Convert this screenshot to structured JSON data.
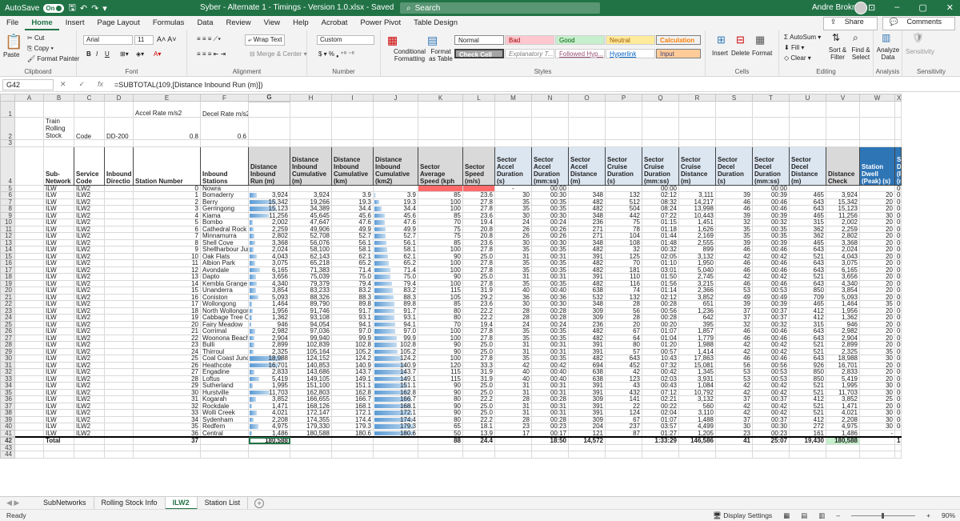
{
  "titlebar": {
    "autosave": "AutoSave",
    "toggle": "On",
    "title": "Syber - Alternate 1 - Timings - Version 1.0.xlsx  -  Saved",
    "search": "Search",
    "user": "Andre Brokman"
  },
  "menu": {
    "items": [
      "File",
      "Home",
      "Insert",
      "Page Layout",
      "Formulas",
      "Data",
      "Review",
      "View",
      "Help",
      "Acrobat",
      "Power Pivot",
      "Table Design"
    ],
    "share": "Share",
    "comments": "Comments"
  },
  "ribbon": {
    "clipboard": {
      "paste": "Paste",
      "cut": "Cut",
      "copy": "Copy",
      "format_painter": "Format Painter",
      "label": "Clipboard"
    },
    "font": {
      "name": "Arial",
      "size": "11",
      "label": "Font"
    },
    "alignment": {
      "wrap": "Wrap Text",
      "merge": "Merge & Center",
      "label": "Alignment"
    },
    "number": {
      "format": "Custom",
      "label": "Number"
    },
    "styles": {
      "conditional": "Conditional Formatting",
      "format_as_table": "Format as Table",
      "normal": "Normal",
      "bad": "Bad",
      "good": "Good",
      "neutral": "Neutral",
      "calculation": "Calculation",
      "check_cell": "Check Cell",
      "explanatory": "Explanatory T...",
      "followed": "Followed Hyp...",
      "hyperlink": "Hyperlink",
      "input": "Input",
      "label": "Styles"
    },
    "cells": {
      "insert": "Insert",
      "delete": "Delete",
      "format": "Format",
      "label": "Cells"
    },
    "editing": {
      "autosum": "AutoSum",
      "fill": "Fill",
      "clear": "Clear",
      "sort": "Sort & Filter",
      "find": "Find & Select",
      "label": "Editing"
    },
    "analysis": {
      "analyze": "Analyze Data",
      "label": "Analysis"
    },
    "sensitivity": {
      "name": "Sensitivity",
      "label": "Sensitivity"
    }
  },
  "formula": {
    "cell": "G42",
    "fx": "fx",
    "value": "=SUBTOTAL(109,[Distance Inbound Run (m)])"
  },
  "columns": [
    "A",
    "B",
    "C",
    "D",
    "E",
    "F",
    "G",
    "H",
    "I",
    "J",
    "K",
    "L",
    "M",
    "N",
    "O",
    "P",
    "Q",
    "R",
    "S",
    "T",
    "U",
    "V",
    "W",
    "X",
    "Y"
  ],
  "top_rows": {
    "r1": {
      "e": "Accel Rate m/s2",
      "f": "Decel Rate m/s2"
    },
    "r2": {
      "b": "Train Rolling Stock",
      "c": "Code",
      "d": "DD-200",
      "e": "0.8",
      "f": "0.6"
    }
  },
  "headers": [
    "Sub-Network",
    "Service Code",
    "Inbound Directio",
    "Station Number",
    "Inbound Stations",
    "Distance Inbound Run (m)",
    "Distance Inbound Cumulative (m)",
    "Distance Inbound Cumulative (km)",
    "Distance Inbound Cumulative (km2)",
    "Sector Average Speed (kph",
    "Sector Speed (m/s)",
    "Sector Accel Duration (s)",
    "Sector Accel Duration (mm:ss)",
    "Sector Accel Distance (m)",
    "Sector Cruise Duration (s)",
    "Sector Cruise Duration (mm:ss)",
    "Sector Cruise Distance (m)",
    "Sector Decel Duration (s)",
    "Sector Decel Duration (mm:ss)",
    "Sector Decel Distance (m)",
    "Distance Check",
    "Station Dwell (Peak) (s)",
    "Station Dwell (Peak) (mm:ss)",
    "Sector Travel (s)"
  ],
  "rows": [
    [
      "ILW",
      "ILW2",
      "",
      "0",
      "Nowra",
      "",
      "",
      "",
      "",
      "",
      "",
      "-",
      "00:00",
      "",
      "",
      "00:00",
      "",
      "",
      "00:00",
      "",
      "",
      "",
      "00:00",
      ""
    ],
    [
      "ILW",
      "ILW2",
      "",
      "1",
      "Bomaderry",
      "3,924",
      "3,924",
      "3.9",
      "3.9",
      "85",
      "23.6",
      "30",
      "00:30",
      "348",
      "132",
      "02:12",
      "3,111",
      "39",
      "00:39",
      "465",
      "3,924",
      "20",
      "00:20",
      ""
    ],
    [
      "ILW",
      "ILW2",
      "",
      "2",
      "Berry",
      "15,342",
      "19,266",
      "19.3",
      "19.3",
      "100",
      "27.8",
      "35",
      "00:35",
      "482",
      "512",
      "08:32",
      "14,217",
      "46",
      "00:46",
      "643",
      "15,342",
      "20",
      "00:20",
      ""
    ],
    [
      "ILW",
      "ILW2",
      "",
      "3",
      "Gerringong",
      "15,123",
      "34,389",
      "34.4",
      "34.4",
      "100",
      "27.8",
      "35",
      "00:35",
      "482",
      "504",
      "08:24",
      "13,998",
      "46",
      "00:46",
      "643",
      "15,123",
      "20",
      "00:20",
      ""
    ],
    [
      "ILW",
      "ILW2",
      "",
      "4",
      "Kiama",
      "11,256",
      "45,645",
      "45.6",
      "45.6",
      "85",
      "23.6",
      "30",
      "00:30",
      "348",
      "442",
      "07:22",
      "10,443",
      "39",
      "00:39",
      "465",
      "11,256",
      "30",
      "00:30",
      ""
    ],
    [
      "ILW",
      "ILW2",
      "",
      "5",
      "Bombo",
      "2,002",
      "47,647",
      "47.6",
      "47.6",
      "70",
      "19.4",
      "24",
      "00:24",
      "236",
      "75",
      "01:15",
      "1,451",
      "32",
      "00:32",
      "315",
      "2,002",
      "20",
      "00:20",
      ""
    ],
    [
      "ILW",
      "ILW2",
      "",
      "6",
      "Cathedral Rock",
      "2,259",
      "49,906",
      "49.9",
      "49.9",
      "75",
      "20.8",
      "26",
      "00:26",
      "271",
      "78",
      "01:18",
      "1,626",
      "35",
      "00:35",
      "362",
      "2,259",
      "20",
      "00:20",
      ""
    ],
    [
      "ILW",
      "ILW2",
      "",
      "7",
      "Minnamurra",
      "2,802",
      "52,708",
      "52.7",
      "52.7",
      "75",
      "20.8",
      "26",
      "00:26",
      "271",
      "104",
      "01:44",
      "2,169",
      "35",
      "00:35",
      "362",
      "2,802",
      "20",
      "00:20",
      ""
    ],
    [
      "ILW",
      "ILW2",
      "",
      "8",
      "Shell Cove",
      "3,368",
      "56,076",
      "56.1",
      "56.1",
      "85",
      "23.6",
      "30",
      "00:30",
      "348",
      "108",
      "01:48",
      "2,555",
      "39",
      "00:39",
      "465",
      "3,368",
      "20",
      "00:20",
      ""
    ],
    [
      "ILW",
      "ILW2",
      "",
      "9",
      "Shellharbour Junction",
      "2,024",
      "58,100",
      "58.1",
      "58.1",
      "100",
      "27.8",
      "35",
      "00:35",
      "482",
      "32",
      "00:32",
      "899",
      "46",
      "00:46",
      "643",
      "2,024",
      "20",
      "00:20",
      ""
    ],
    [
      "ILW",
      "ILW2",
      "",
      "10",
      "Oak Flats",
      "4,043",
      "62,143",
      "62.1",
      "62.1",
      "90",
      "25.0",
      "31",
      "00:31",
      "391",
      "125",
      "02:05",
      "3,132",
      "42",
      "00:42",
      "521",
      "4,043",
      "20",
      "00:20",
      ""
    ],
    [
      "ILW",
      "ILW2",
      "",
      "11",
      "Albion Park",
      "3,075",
      "65,218",
      "65.2",
      "65.2",
      "100",
      "27.8",
      "35",
      "00:35",
      "482",
      "70",
      "01:10",
      "1,950",
      "46",
      "00:46",
      "643",
      "3,075",
      "20",
      "00:20",
      ""
    ],
    [
      "ILW",
      "ILW2",
      "",
      "12",
      "Avondale",
      "6,165",
      "71,383",
      "71.4",
      "71.4",
      "100",
      "27.8",
      "35",
      "00:35",
      "482",
      "181",
      "03:01",
      "5,040",
      "46",
      "00:46",
      "643",
      "6,165",
      "20",
      "00:20",
      ""
    ],
    [
      "ILW",
      "ILW2",
      "",
      "13",
      "Dapto",
      "3,656",
      "75,039",
      "75.0",
      "75.0",
      "90",
      "25.0",
      "31",
      "00:31",
      "391",
      "110",
      "01:50",
      "2,745",
      "42",
      "00:42",
      "521",
      "3,656",
      "20",
      "00:20",
      ""
    ],
    [
      "ILW",
      "ILW2",
      "",
      "14",
      "Kembla Grange",
      "4,340",
      "79,379",
      "79.4",
      "79.4",
      "100",
      "27.8",
      "35",
      "00:35",
      "482",
      "116",
      "01:56",
      "3,215",
      "46",
      "00:46",
      "643",
      "4,340",
      "20",
      "00:20",
      ""
    ],
    [
      "ILW",
      "ILW2",
      "",
      "15",
      "Unanderra",
      "3,854",
      "83,233",
      "83.2",
      "83.2",
      "115",
      "31.9",
      "40",
      "00:40",
      "638",
      "74",
      "01:14",
      "2,366",
      "53",
      "00:53",
      "850",
      "3,854",
      "20",
      "00:20",
      ""
    ],
    [
      "ILW",
      "ILW2",
      "",
      "16",
      "Coniston",
      "5,093",
      "88,326",
      "88.3",
      "88.3",
      "105",
      "29.2",
      "36",
      "00:36",
      "532",
      "132",
      "02:12",
      "3,852",
      "49",
      "00:49",
      "709",
      "5,093",
      "20",
      "00:20",
      ""
    ],
    [
      "ILW",
      "ILW2",
      "",
      "17",
      "Wollongong",
      "1,464",
      "89,790",
      "89.8",
      "89.8",
      "85",
      "23.6",
      "30",
      "00:30",
      "348",
      "28",
      "00:28",
      "651",
      "39",
      "00:39",
      "465",
      "1,464",
      "35",
      "00:35",
      ""
    ],
    [
      "ILW",
      "ILW2",
      "",
      "18",
      "North Wollongong",
      "1,956",
      "91,746",
      "91.7",
      "91.7",
      "80",
      "22.2",
      "28",
      "00:28",
      "309",
      "56",
      "00:56",
      "1,236",
      "37",
      "00:37",
      "412",
      "1,956",
      "20",
      "00:20",
      ""
    ],
    [
      "ILW",
      "ILW2",
      "",
      "19",
      "Cabbage Tree Creek",
      "1,362",
      "93,108",
      "93.1",
      "93.1",
      "80",
      "22.2",
      "28",
      "00:28",
      "309",
      "28",
      "00:28",
      "642",
      "37",
      "00:37",
      "412",
      "1,362",
      "20",
      "00:20",
      ""
    ],
    [
      "ILW",
      "ILW2",
      "",
      "20",
      "Fairy Meadow",
      "946",
      "94,054",
      "94.1",
      "94.1",
      "70",
      "19.4",
      "24",
      "00:24",
      "236",
      "20",
      "00:20",
      "395",
      "32",
      "00:32",
      "315",
      "946",
      "20",
      "00:20",
      ""
    ],
    [
      "ILW",
      "ILW2",
      "",
      "21",
      "Corrimal",
      "2,982",
      "97,036",
      "97.0",
      "97.0",
      "100",
      "27.8",
      "35",
      "00:35",
      "482",
      "67",
      "01:07",
      "1,857",
      "46",
      "00:46",
      "643",
      "2,982",
      "20",
      "00:20",
      ""
    ],
    [
      "ILW",
      "ILW2",
      "",
      "22",
      "Woonona Beach",
      "2,904",
      "99,940",
      "99.9",
      "99.9",
      "100",
      "27.8",
      "35",
      "00:35",
      "482",
      "64",
      "01:04",
      "1,779",
      "46",
      "00:46",
      "643",
      "2,904",
      "20",
      "00:20",
      ""
    ],
    [
      "ILW",
      "ILW2",
      "",
      "23",
      "Bulli",
      "2,899",
      "102,839",
      "102.8",
      "102.8",
      "90",
      "25.0",
      "31",
      "00:31",
      "391",
      "80",
      "01:20",
      "1,988",
      "42",
      "00:42",
      "521",
      "2,899",
      "20",
      "00:20",
      ""
    ],
    [
      "ILW",
      "ILW2",
      "",
      "24",
      "Thirroul",
      "2,325",
      "105,164",
      "105.2",
      "105.2",
      "90",
      "25.0",
      "31",
      "00:31",
      "391",
      "57",
      "00:57",
      "1,414",
      "42",
      "00:42",
      "521",
      "2,325",
      "35",
      "00:35",
      ""
    ],
    [
      "ILW",
      "ILW2",
      "",
      "25",
      "Coal Coast Junction",
      "18,988",
      "124,152",
      "124.2",
      "124.2",
      "100",
      "27.8",
      "35",
      "00:35",
      "482",
      "643",
      "10:43",
      "17,863",
      "46",
      "00:46",
      "643",
      "18,988",
      "30",
      "00:30",
      ""
    ],
    [
      "ILW",
      "ILW2",
      "",
      "26",
      "Heathcote",
      "16,701",
      "140,853",
      "140.9",
      "140.9",
      "120",
      "33.3",
      "42",
      "00:42",
      "694",
      "452",
      "07:32",
      "15,081",
      "56",
      "00:56",
      "926",
      "16,701",
      "20",
      "00:20",
      ""
    ],
    [
      "ILW",
      "ILW2",
      "",
      "27",
      "Engadine",
      "2,833",
      "143,686",
      "143.7",
      "143.7",
      "115",
      "31.9",
      "40",
      "00:40",
      "638",
      "42",
      "00:42",
      "1,345",
      "53",
      "00:53",
      "850",
      "2,833",
      "20",
      "00:20",
      ""
    ],
    [
      "ILW",
      "ILW2",
      "",
      "28",
      "Loftus",
      "5,419",
      "149,105",
      "149.1",
      "149.1",
      "115",
      "31.9",
      "40",
      "00:40",
      "638",
      "123",
      "02:03",
      "3,931",
      "53",
      "00:53",
      "850",
      "5,419",
      "20",
      "00:20",
      ""
    ],
    [
      "ILW",
      "ILW2",
      "",
      "29",
      "Sutherland",
      "1,995",
      "151,100",
      "151.1",
      "151.1",
      "90",
      "25.0",
      "31",
      "00:31",
      "391",
      "43",
      "00:43",
      "1,084",
      "42",
      "00:42",
      "521",
      "1,995",
      "30",
      "00:30",
      ""
    ],
    [
      "ILW",
      "ILW2",
      "",
      "30",
      "Hurstville",
      "11,703",
      "162,803",
      "162.8",
      "162.8",
      "90",
      "25.0",
      "31",
      "00:31",
      "391",
      "432",
      "07:12",
      "10,792",
      "42",
      "00:42",
      "521",
      "11,703",
      "30",
      "00:30",
      ""
    ],
    [
      "ILW",
      "ILW2",
      "",
      "31",
      "Kogarah",
      "3,852",
      "166,655",
      "166.7",
      "166.7",
      "80",
      "22.2",
      "28",
      "00:28",
      "309",
      "141",
      "02:21",
      "3,132",
      "37",
      "00:37",
      "412",
      "3,852",
      "25",
      "00:25",
      ""
    ],
    [
      "ILW",
      "ILW2",
      "",
      "32",
      "Rockdale",
      "1,471",
      "168,126",
      "168.1",
      "168.1",
      "90",
      "25.0",
      "31",
      "00:31",
      "391",
      "22",
      "00:22",
      "560",
      "42",
      "00:42",
      "521",
      "1,471",
      "20",
      "00:20",
      ""
    ],
    [
      "ILW",
      "ILW2",
      "",
      "33",
      "Wolli Creek",
      "4,021",
      "172,147",
      "172.1",
      "172.1",
      "90",
      "25.0",
      "31",
      "00:31",
      "391",
      "124",
      "02:04",
      "3,110",
      "42",
      "00:42",
      "521",
      "4,021",
      "30",
      "00:30",
      ""
    ],
    [
      "ILW",
      "ILW2",
      "",
      "34",
      "Sydenham",
      "2,208",
      "174,355",
      "174.4",
      "174.4",
      "80",
      "22.2",
      "28",
      "00:28",
      "309",
      "67",
      "01:07",
      "1,488",
      "37",
      "00:37",
      "412",
      "2,208",
      "30",
      "00:30",
      ""
    ],
    [
      "ILW",
      "ILW2",
      "",
      "35",
      "Redfern",
      "4,975",
      "179,330",
      "179.3",
      "179.3",
      "65",
      "18.1",
      "23",
      "00:23",
      "204",
      "237",
      "03:57",
      "4,499",
      "30",
      "00:30",
      "272",
      "4,975",
      "30",
      "00:30",
      ""
    ],
    [
      "ILW",
      "ILW2",
      "",
      "36",
      "Central",
      "1,486",
      "180,588",
      "180.6",
      "180.6",
      "50",
      "13.9",
      "17",
      "00:17",
      "121",
      "87",
      "01:27",
      "1,205",
      "23",
      "00:23",
      "161",
      "1,486",
      "-",
      "",
      ""
    ]
  ],
  "total": {
    "label": "Total",
    "count": "37",
    "distance": "180,588",
    "speed": "88",
    "speed_ms": "24.4",
    "accel": "18:50",
    "accel_dist": "14,572",
    "cruise": "1:33:29",
    "cruise_dist": "146,586",
    "decel_s": "41",
    "decel": "25:07",
    "decel_dist": "19,430",
    "check": "180,588",
    "dwell": "13:35"
  },
  "sheets": {
    "tabs": [
      "SubNetworks",
      "Rolling Stock Info",
      "ILW2",
      "Station List"
    ],
    "active": "ILW2"
  },
  "status": {
    "ready": "Ready",
    "display": "Display Settings",
    "zoom": "90%"
  },
  "colors": {
    "excel_green": "#217346",
    "header_blue": "#2e75b6",
    "databar": "#5b9bd5"
  }
}
